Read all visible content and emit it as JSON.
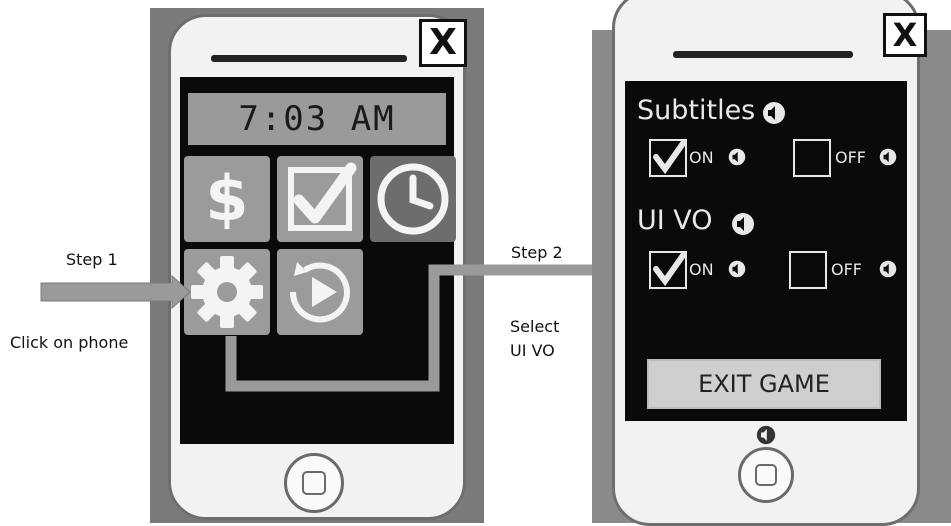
{
  "labels": {
    "step1": "Step 1",
    "step1_action": "Click on phone",
    "step2": "Step 2",
    "step2_action_line1": "Select",
    "step2_action_line2": "UI VO"
  },
  "phone_left": {
    "close_label": "X",
    "time": "7:03 AM",
    "dollar_symbol": "$"
  },
  "phone_right": {
    "close_label": "X",
    "subtitles": {
      "label": "Subtitles",
      "on_label": "ON",
      "off_label": "OFF",
      "on_checked": true,
      "off_checked": false
    },
    "ui_vo": {
      "label": "UI VO",
      "on_label": "ON",
      "off_label": "OFF",
      "on_checked": true,
      "off_checked": false
    },
    "exit_label": "EXIT GAME"
  },
  "colors": {
    "arrow": "#9a9a9a",
    "screen": "#0a0a0a",
    "tile": "#9b9b9b"
  }
}
